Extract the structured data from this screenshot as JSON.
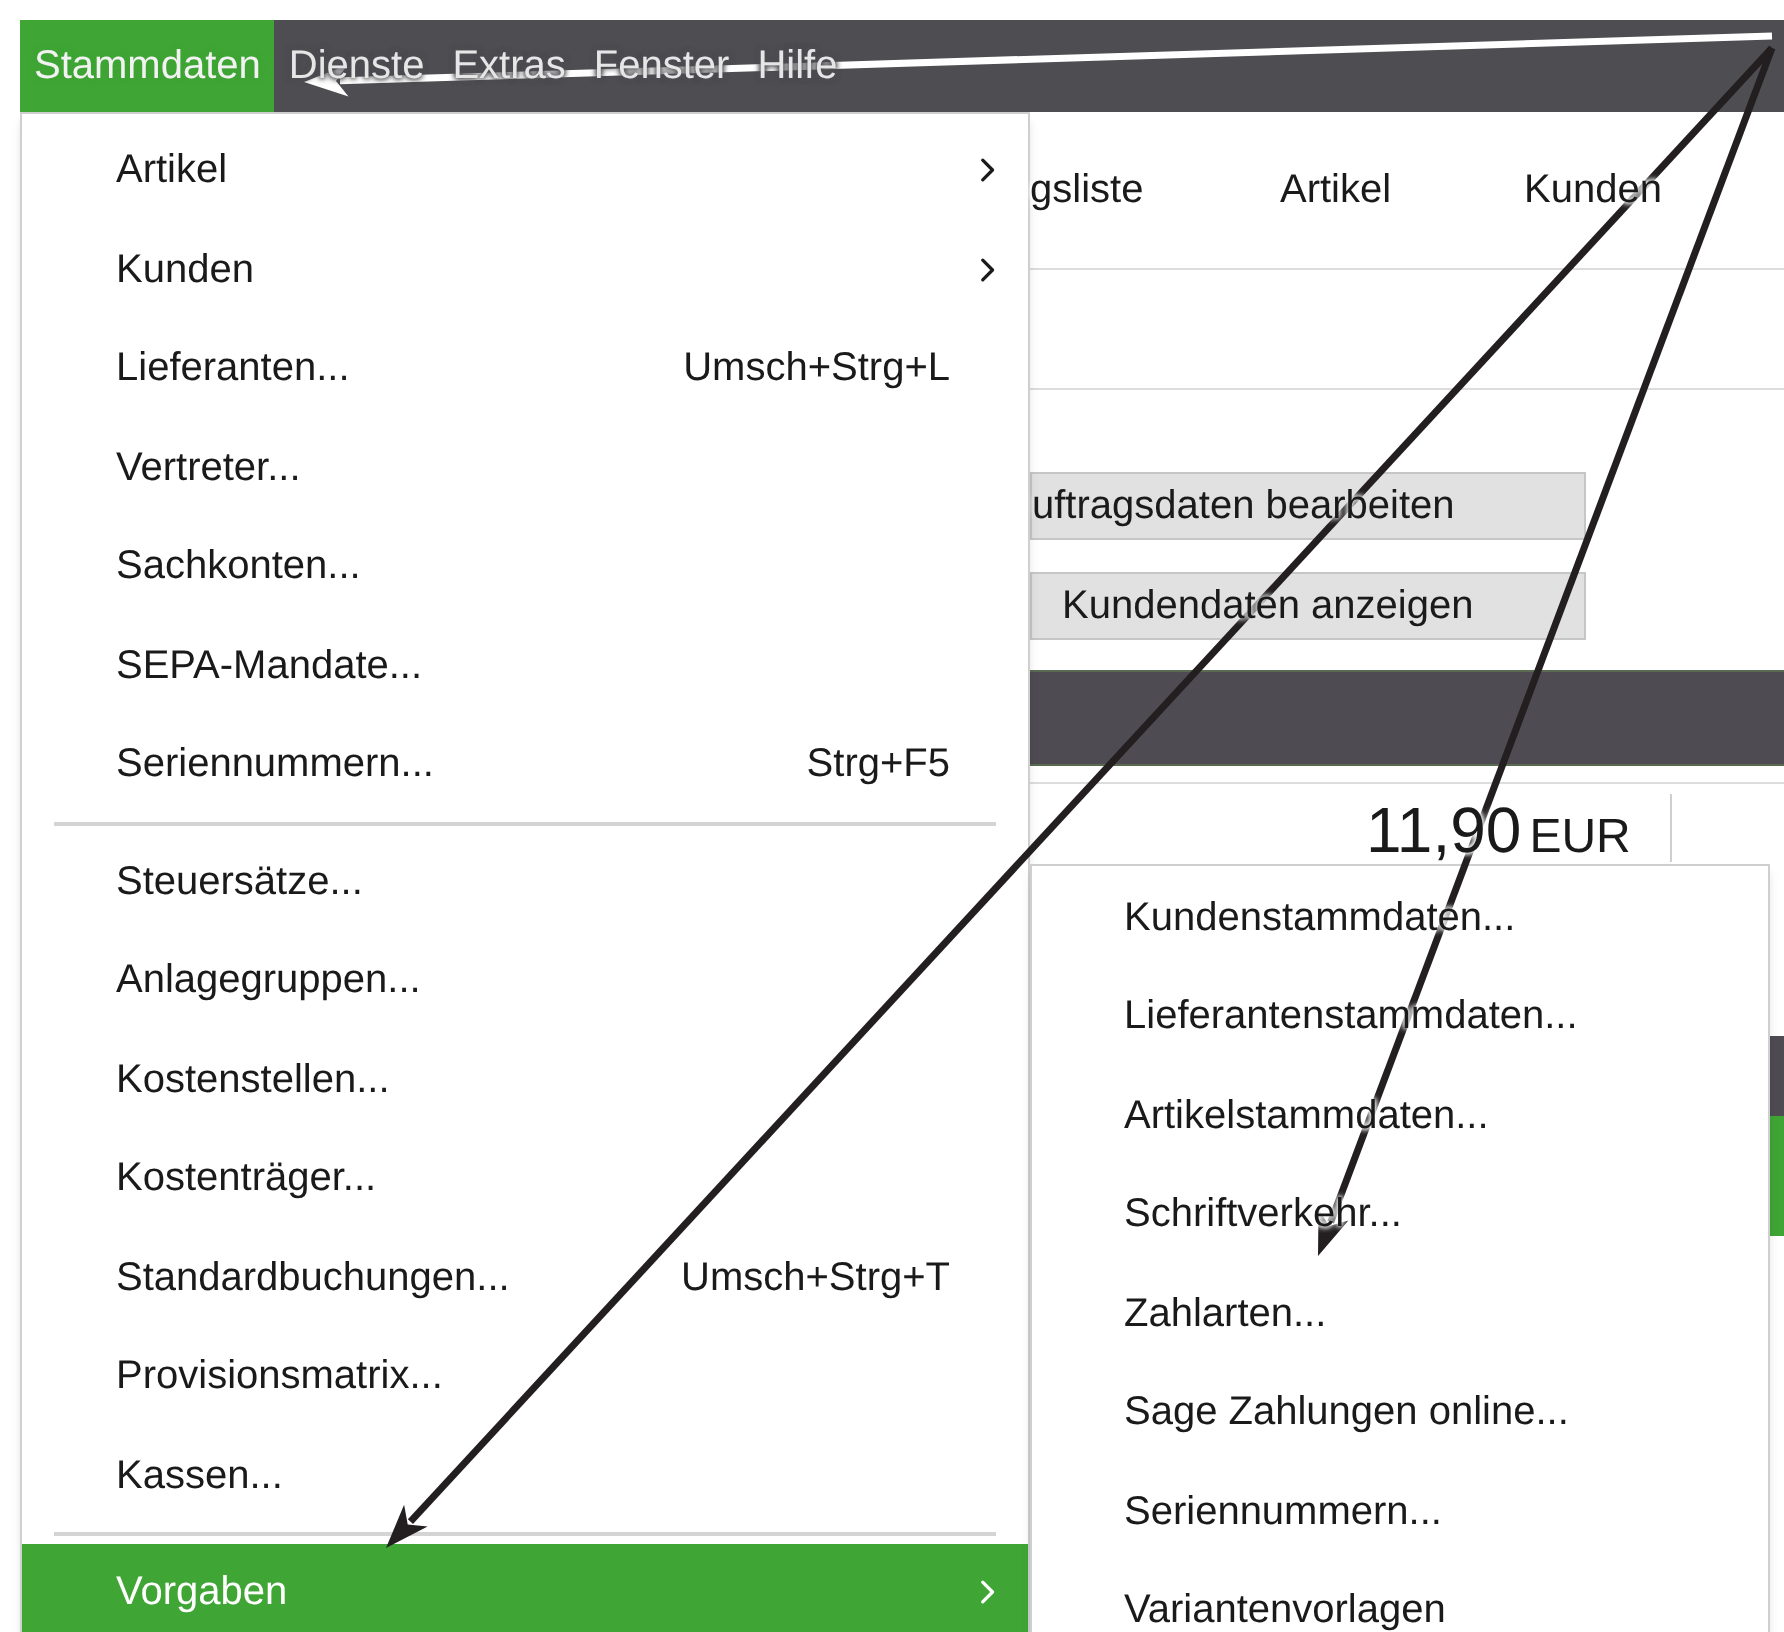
{
  "menu_bar": {
    "items": [
      {
        "label": "Stammdaten",
        "selected": true
      },
      {
        "label": "Dienste",
        "selected": false
      },
      {
        "label": "Extras",
        "selected": false
      },
      {
        "label": "Fenster",
        "selected": false
      },
      {
        "label": "Hilfe",
        "selected": false
      }
    ]
  },
  "background": {
    "tabs": [
      "gsliste",
      "Artikel",
      "Kunden"
    ],
    "buttons": [
      "uftragsdaten bearbeiten",
      "Kundendaten anzeigen"
    ],
    "amount": "11,90",
    "currency": "EUR"
  },
  "menu": {
    "items": [
      {
        "kind": "item",
        "label": "Artikel",
        "submenu": true,
        "selected": false
      },
      {
        "kind": "item",
        "label": "Kunden",
        "submenu": true,
        "selected": false
      },
      {
        "kind": "item",
        "label": "Lieferanten...",
        "shortcut": "Umsch+Strg+L",
        "selected": false
      },
      {
        "kind": "item",
        "label": "Vertreter...",
        "selected": false
      },
      {
        "kind": "item",
        "label": "Sachkonten...",
        "selected": false
      },
      {
        "kind": "item",
        "label": "SEPA-Mandate...",
        "selected": false
      },
      {
        "kind": "item",
        "label": "Seriennummern...",
        "shortcut": "Strg+F5",
        "selected": false
      },
      {
        "kind": "separator"
      },
      {
        "kind": "item",
        "label": "Steuersätze...",
        "selected": false
      },
      {
        "kind": "item",
        "label": "Anlagegruppen...",
        "selected": false
      },
      {
        "kind": "item",
        "label": "Kostenstellen...",
        "selected": false
      },
      {
        "kind": "item",
        "label": "Kostenträger...",
        "selected": false
      },
      {
        "kind": "item",
        "label": "Standardbuchungen...",
        "shortcut": "Umsch+Strg+T",
        "selected": false
      },
      {
        "kind": "item",
        "label": "Provisionsmatrix...",
        "selected": false
      },
      {
        "kind": "item",
        "label": "Kassen...",
        "selected": false
      },
      {
        "kind": "separator"
      },
      {
        "kind": "item",
        "label": "Vorgaben",
        "submenu": true,
        "selected": true
      }
    ]
  },
  "submenu": {
    "items": [
      "Kundenstammdaten...",
      "Lieferantenstammdaten...",
      "Artikelstammdaten...",
      "Schriftverkehr...",
      "Zahlarten...",
      "Sage Zahlungen online...",
      "Seriennummern...",
      "Variantenvorlagen"
    ]
  }
}
